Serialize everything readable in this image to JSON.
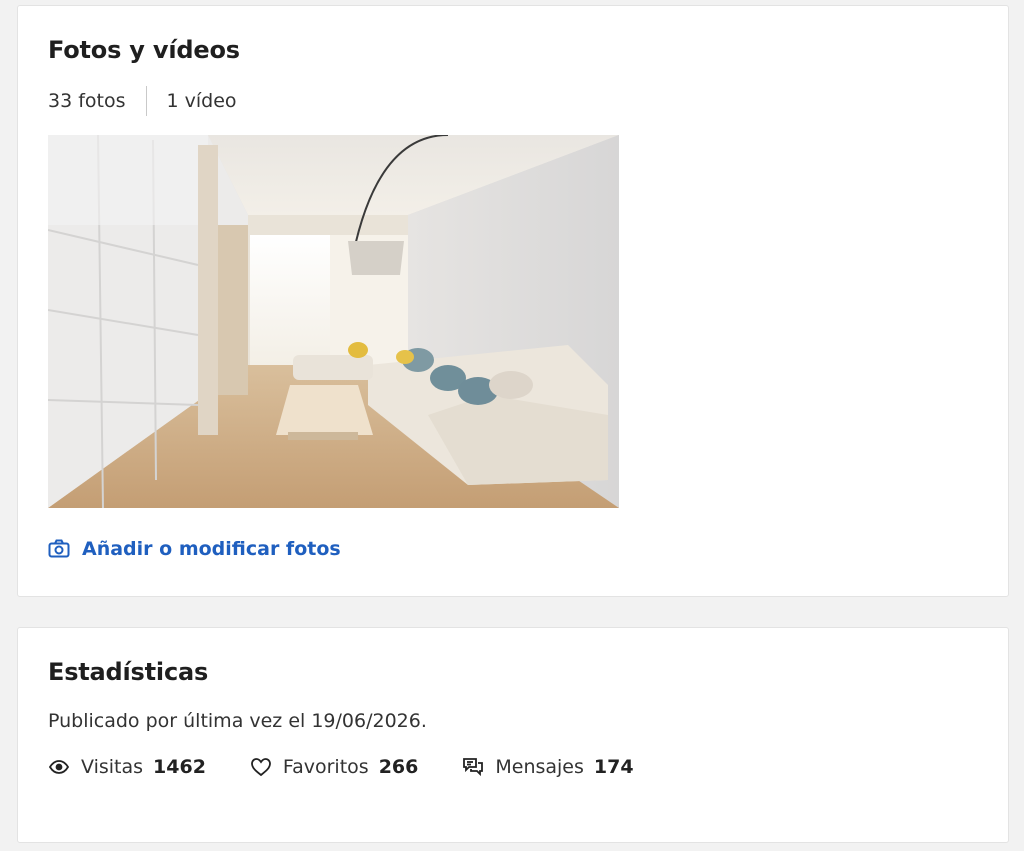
{
  "photos_section": {
    "title": "Fotos y vídeos",
    "photo_count": "33 fotos",
    "video_count": "1 vídeo",
    "add_link": "Añadir o modificar fotos",
    "icons": {
      "add_link": "camera-icon"
    }
  },
  "stats_section": {
    "title": "Estadísticas",
    "published": "Publicado por última vez el 19/06/2026.",
    "metrics": [
      {
        "label": "Visitas",
        "value": "1462",
        "icon": "eye-icon"
      },
      {
        "label": "Favoritos",
        "value": "266",
        "icon": "heart-icon"
      },
      {
        "label": "Mensajes",
        "value": "174",
        "icon": "chat-icon"
      }
    ]
  },
  "colors": {
    "link": "#1f5fbf",
    "background": "#f2f2f2",
    "card": "#ffffff"
  }
}
